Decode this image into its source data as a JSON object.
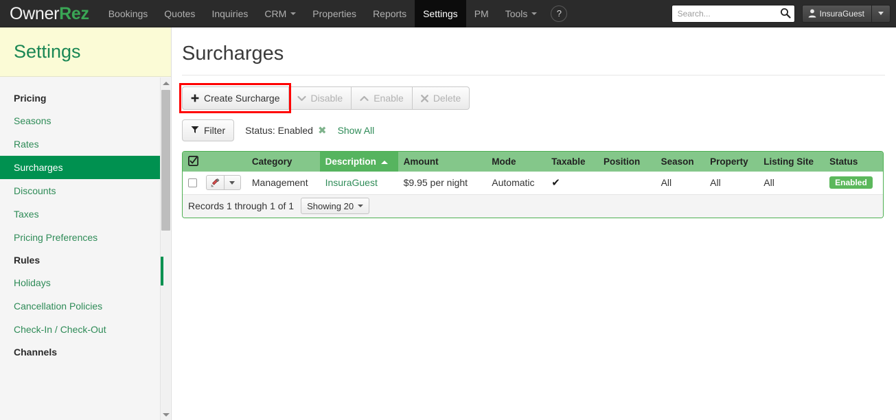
{
  "navbar": {
    "brand_part1": "Owner",
    "brand_part2": "Rez",
    "items": [
      {
        "label": "Bookings",
        "active": false,
        "caret": false
      },
      {
        "label": "Quotes",
        "active": false,
        "caret": false
      },
      {
        "label": "Inquiries",
        "active": false,
        "caret": false
      },
      {
        "label": "CRM",
        "active": false,
        "caret": true
      },
      {
        "label": "Properties",
        "active": false,
        "caret": false
      },
      {
        "label": "Reports",
        "active": false,
        "caret": false
      },
      {
        "label": "Settings",
        "active": true,
        "caret": false
      },
      {
        "label": "PM",
        "active": false,
        "caret": false
      },
      {
        "label": "Tools",
        "active": false,
        "caret": true
      }
    ],
    "help_label": "?",
    "search_placeholder": "Search...",
    "search_value": "",
    "user_label": "InsuraGuest"
  },
  "sidebar": {
    "title": "Settings",
    "items": [
      {
        "label": "Pricing",
        "type": "header"
      },
      {
        "label": "Seasons",
        "type": "link"
      },
      {
        "label": "Rates",
        "type": "link"
      },
      {
        "label": "Surcharges",
        "type": "link-active"
      },
      {
        "label": "Discounts",
        "type": "link"
      },
      {
        "label": "Taxes",
        "type": "link"
      },
      {
        "label": "Pricing Preferences",
        "type": "link"
      },
      {
        "label": "Rules",
        "type": "header"
      },
      {
        "label": "Holidays",
        "type": "link"
      },
      {
        "label": "Cancellation Policies",
        "type": "link"
      },
      {
        "label": "Check-In / Check-Out",
        "type": "link"
      },
      {
        "label": "Channels",
        "type": "header"
      }
    ]
  },
  "main": {
    "page_title": "Surcharges",
    "toolbar": {
      "create_label": "Create Surcharge",
      "disable_label": "Disable",
      "enable_label": "Enable",
      "delete_label": "Delete"
    },
    "filter": {
      "filter_label": "Filter",
      "status_text": "Status: Enabled",
      "remove_icon": "✖",
      "show_all_label": "Show All"
    },
    "table": {
      "columns": [
        {
          "label": "",
          "sorted": false,
          "icon": "select-all-checkbox"
        },
        {
          "label": "Category",
          "sorted": false
        },
        {
          "label": "Description",
          "sorted": true,
          "sort_dir": "asc"
        },
        {
          "label": "Amount",
          "sorted": false
        },
        {
          "label": "Mode",
          "sorted": false
        },
        {
          "label": "Taxable",
          "sorted": false
        },
        {
          "label": "Position",
          "sorted": false
        },
        {
          "label": "Season",
          "sorted": false
        },
        {
          "label": "Property",
          "sorted": false
        },
        {
          "label": "Listing Site",
          "sorted": false
        },
        {
          "label": "Status",
          "sorted": false
        }
      ],
      "rows": [
        {
          "category": "Management",
          "description": "InsuraGuest",
          "amount": "$9.95 per night",
          "mode": "Automatic",
          "taxable": "✔",
          "position": "",
          "season": "All",
          "property": "All",
          "listing_site": "All",
          "status": "Enabled"
        }
      ],
      "footer": {
        "records_text": "Records 1 through 1 of 1",
        "showing_label": "Showing 20"
      }
    }
  },
  "colors": {
    "brand_green": "#3aa655",
    "navbar_bg": "#2b2b2b",
    "sidebar_active": "#009150",
    "sidebar_head_bg": "#fbfbd6",
    "table_header_green": "#84c78a",
    "table_sorted_green": "#56b45f",
    "badge_green": "#5cb85c",
    "highlight_red": "#ff0000",
    "link_green": "#2e8b57"
  }
}
